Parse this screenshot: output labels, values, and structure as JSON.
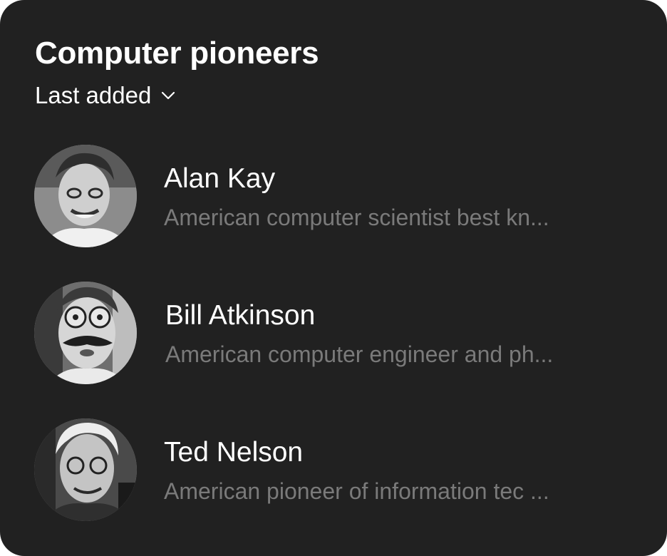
{
  "header": {
    "title": "Computer pioneers",
    "sort_label": "Last added",
    "sort_icon": "chevron-down-icon"
  },
  "people": [
    {
      "name": "Alan Kay",
      "description": "American computer scientist best kn...",
      "avatar_icon": "portrait-photo"
    },
    {
      "name": "Bill Atkinson",
      "description": "American computer engineer and ph...",
      "avatar_icon": "portrait-photo"
    },
    {
      "name": "Ted Nelson",
      "description": "American pioneer of information tec ...",
      "avatar_icon": "portrait-photo"
    }
  ],
  "colors": {
    "card_background": "#212121",
    "primary_text": "#ffffff",
    "secondary_text": "#7a7a7a"
  }
}
